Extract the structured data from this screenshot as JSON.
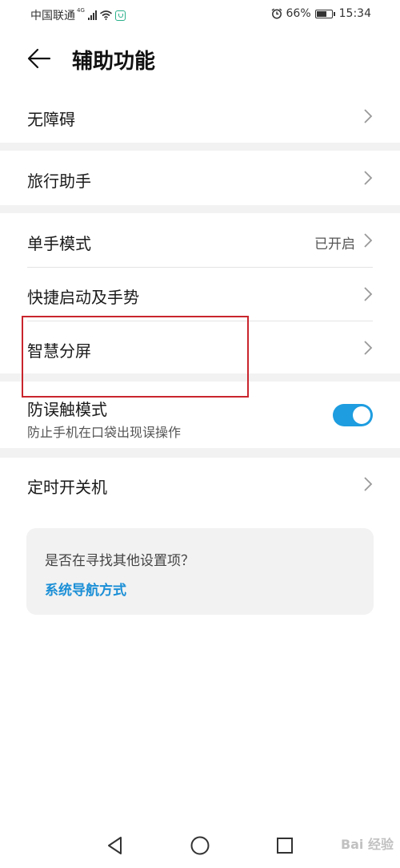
{
  "status_bar": {
    "carrier": "中国联通",
    "network_tag": "4G",
    "battery": "66%",
    "battery_level": 0.66,
    "time": "15:34"
  },
  "header": {
    "title": "辅助功能",
    "back_icon": "arrow-left-icon"
  },
  "list": {
    "accessibility": "无障碍",
    "travel_assistant": "旅行助手",
    "one_hand_mode": "单手模式",
    "one_hand_mode_status": "已开启",
    "shortcuts_gestures": "快捷启动及手势",
    "smart_split_screen": "智慧分屏",
    "pocket_mode": "防误触模式",
    "pocket_mode_desc": "防止手机在口袋出现误操作",
    "pocket_mode_enabled": true,
    "scheduled_power": "定时开关机"
  },
  "suggestion": {
    "question": "是否在寻找其他设置项？",
    "link": "系统导航方式"
  },
  "watermark": "Bai 经验",
  "colors": {
    "accent": "#1e9de0",
    "link": "#1b8fd6",
    "annotation": "#c9252c",
    "group_gap": "#f2f2f2"
  }
}
